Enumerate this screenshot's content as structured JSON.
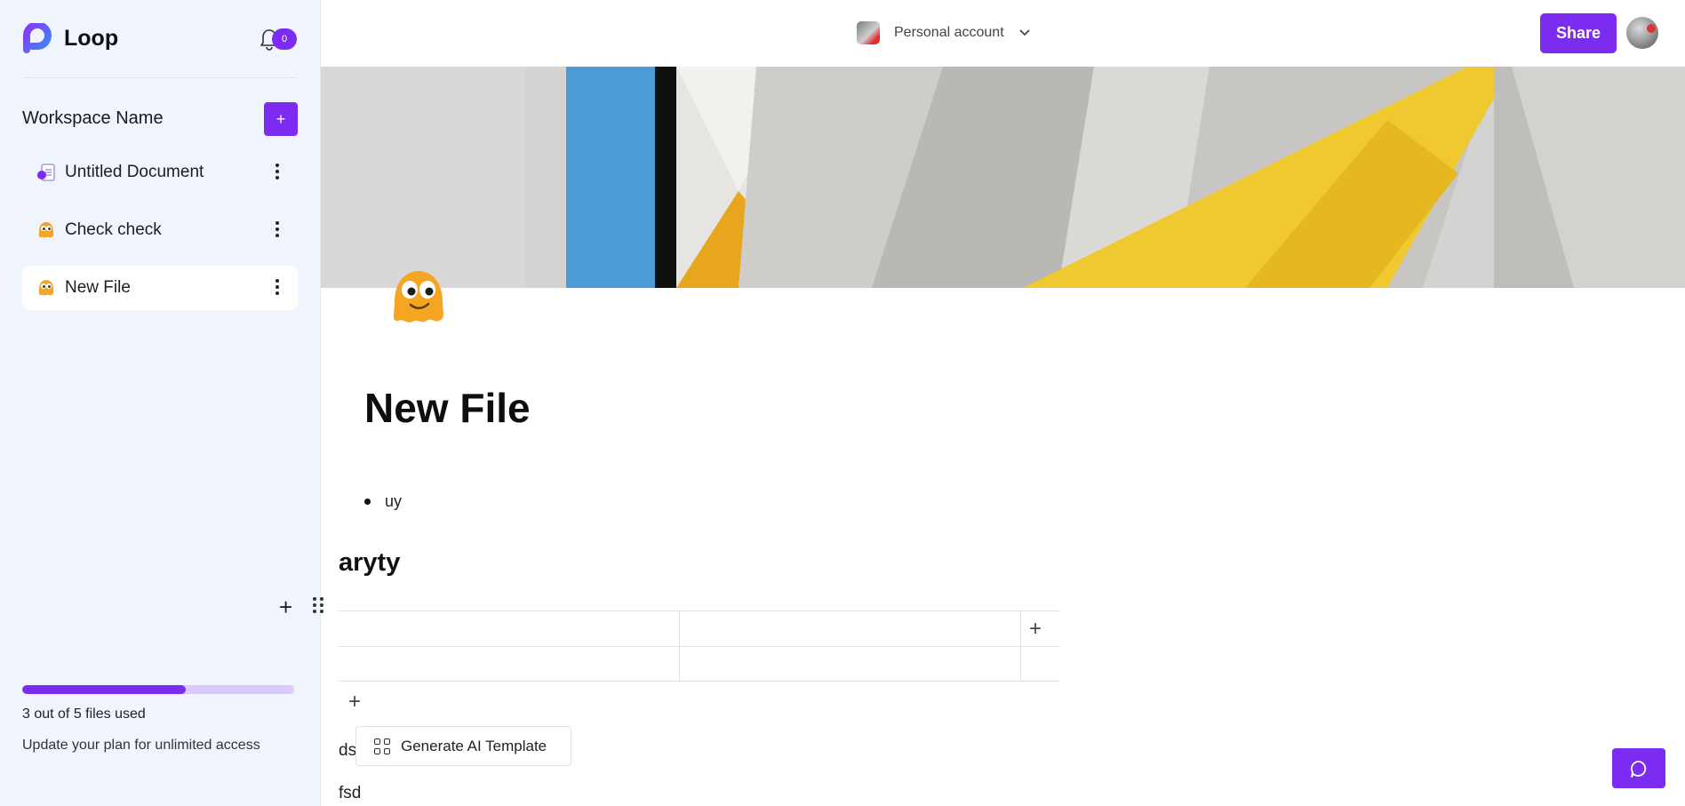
{
  "sidebar": {
    "brand": "Loop",
    "notifications_count": "0",
    "workspace_title": "Workspace Name",
    "add_label": "+",
    "documents": [
      {
        "label": "Untitled Document",
        "icon": "document-icon"
      },
      {
        "label": "Check check",
        "icon": "blob-emoji-icon"
      },
      {
        "label": "New File",
        "icon": "blob-emoji-icon"
      }
    ],
    "storage": {
      "files_used_text": "3 out of 5 files used",
      "usage_fraction": 0.6,
      "upgrade_text": "Update your plan for unlimited access"
    }
  },
  "header": {
    "account_label": "Personal account",
    "share_label": "Share"
  },
  "document": {
    "title": "New File",
    "bullet_items": [
      "uy"
    ],
    "heading": "aryty",
    "table": {
      "rows": 2,
      "cols": 2
    },
    "paragraphs": [
      "ds",
      "fsd"
    ],
    "ai_template_label": "Generate AI Template"
  },
  "colors": {
    "accent": "#7c2cf0",
    "sidebar_bg": "#eff4fd"
  }
}
